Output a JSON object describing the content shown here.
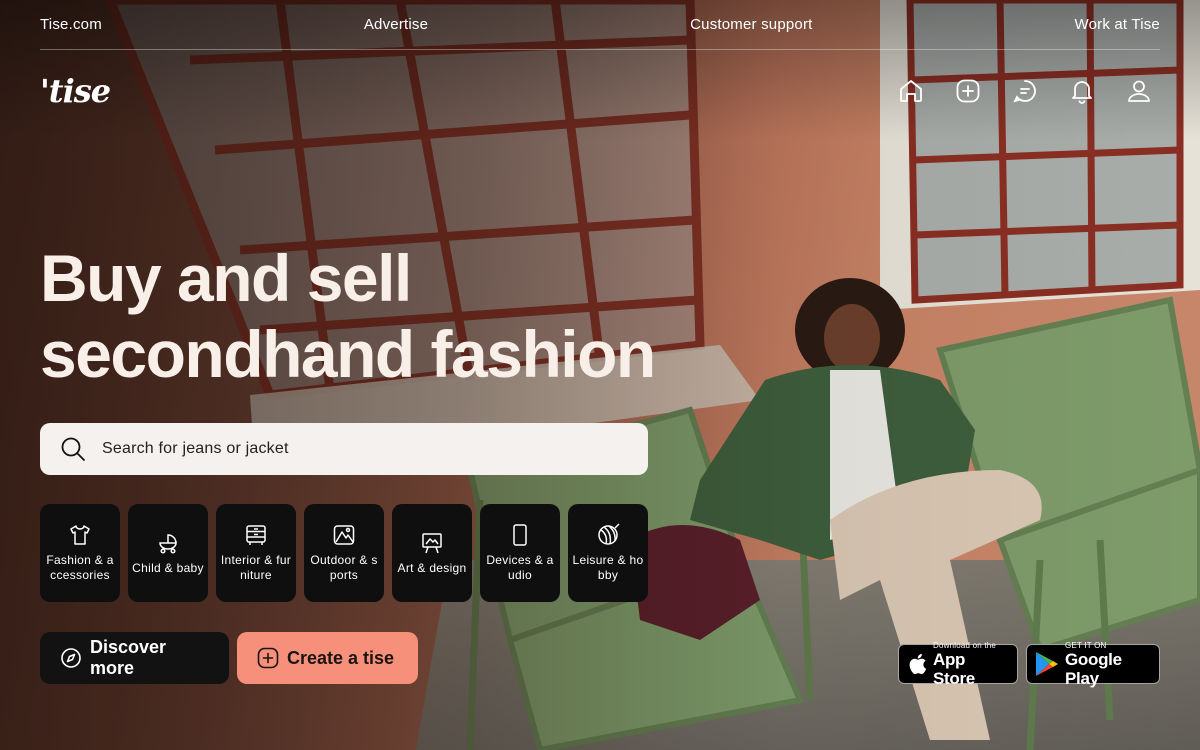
{
  "utility_bar": {
    "links": [
      "Tise.com",
      "Advertise",
      "Customer support",
      "Work at Tise"
    ]
  },
  "header": {
    "logo": "'tise",
    "icons": [
      "home-icon",
      "add-icon",
      "messages-icon",
      "notifications-icon",
      "profile-icon"
    ]
  },
  "hero": {
    "title_line1": "Buy and sell",
    "title_line2": "secondhand fashion"
  },
  "search": {
    "placeholder": "Search for jeans or jacket",
    "value": ""
  },
  "categories": [
    {
      "label": "Fashion & accessories",
      "icon": "tshirt-icon"
    },
    {
      "label": "Child & baby",
      "icon": "stroller-icon"
    },
    {
      "label": "Interior & furniture",
      "icon": "dresser-icon"
    },
    {
      "label": "Outdoor & sports",
      "icon": "mountain-icon"
    },
    {
      "label": "Art & design",
      "icon": "easel-icon"
    },
    {
      "label": "Devices & audio",
      "icon": "phone-icon"
    },
    {
      "label": "Leisure & hobby",
      "icon": "yarn-ball-icon"
    }
  ],
  "actions": {
    "discover_label": "Discover more",
    "create_label": "Create a tise"
  },
  "stores": {
    "apple_small": "Download on the",
    "apple_big": "App Store",
    "google_small": "GET IT ON",
    "google_big": "Google Play"
  },
  "colors": {
    "create_button": "#f6907a",
    "category_tile": "#0f0f10",
    "search_bg": "#f4f1ee"
  }
}
